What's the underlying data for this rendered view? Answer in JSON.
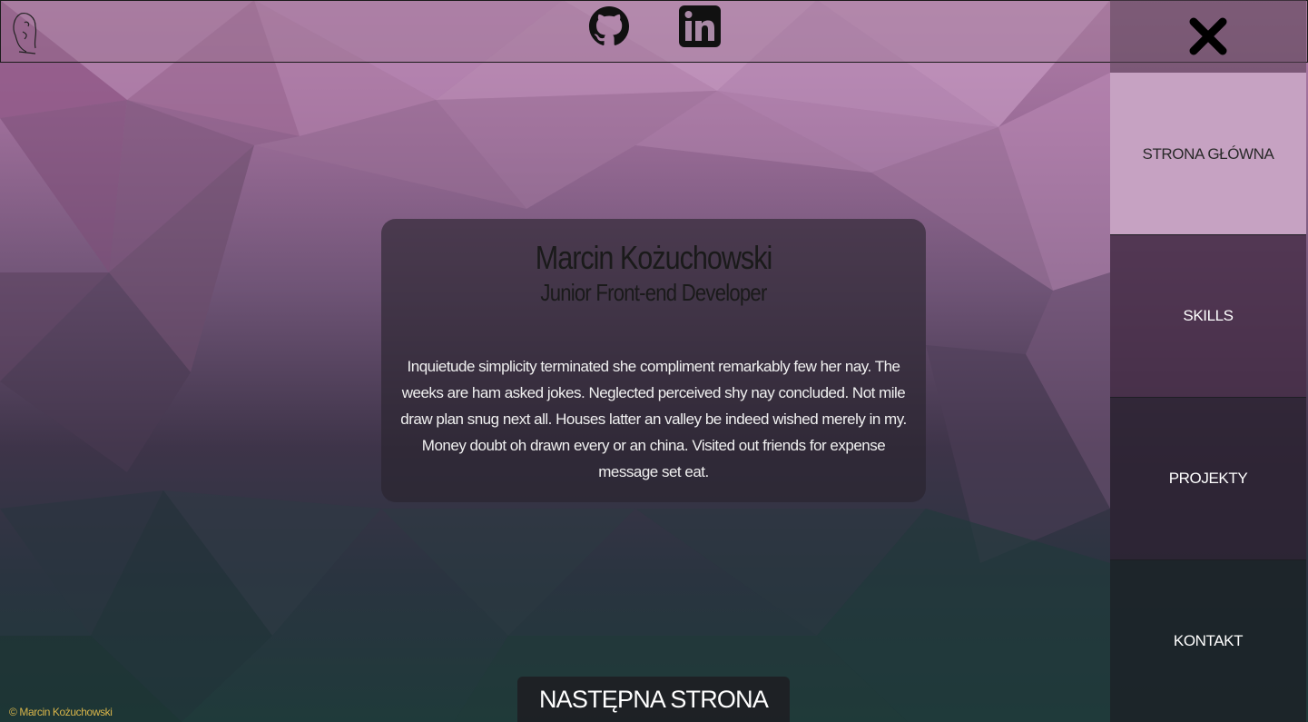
{
  "header": {
    "logo_icon": "signature-portrait-logo",
    "social": [
      {
        "name": "GitHub",
        "icon": "github-icon"
      },
      {
        "name": "LinkedIn",
        "icon": "linkedin-icon"
      }
    ]
  },
  "sidebar": {
    "close_icon": "close-icon",
    "items": [
      {
        "label": "STRONA GŁÓWNA",
        "active": true
      },
      {
        "label": "SKILLS",
        "active": false
      },
      {
        "label": "PROJEKTY",
        "active": false
      },
      {
        "label": "KONTAKT",
        "active": false
      }
    ]
  },
  "card": {
    "name": "Marcin Kożuchowski",
    "role": "Junior Front-end Developer",
    "description": "Inquietude simplicity terminated she compliment remarkably few her nay. The weeks are ham asked jokes. Neglected perceived shy nay concluded. Not mile draw plan snug next all. Houses latter an valley be indeed wished merely in my. Money doubt oh drawn every or an china. Visited out friends for expense message set eat."
  },
  "next_button": {
    "label": "NASTĘPNA STRONA"
  },
  "footer": {
    "copyright": "© Marcin Kożuchowski"
  },
  "colors": {
    "active_nav": "#c6a2c2",
    "copyright": "#d8b54a",
    "card_bg": "#28232d"
  }
}
